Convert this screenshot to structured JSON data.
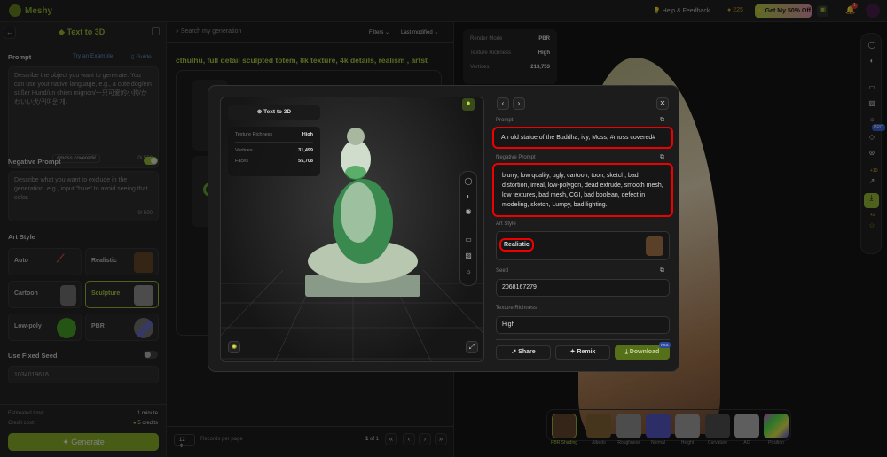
{
  "header": {
    "brand": "Meshy",
    "help": "Help & Feedback",
    "credits": "225",
    "promo": "Get My 50% Off",
    "notifications": "1"
  },
  "left": {
    "back": "←",
    "title": "Text to 3D",
    "prompt_label": "Prompt",
    "try_example": "Try an Example",
    "guide": "Guide",
    "prompt_placeholder": "Describe the object you want to generate. You can use your native language, e.g., a cute dog/ein süßer Hund/un chien mignon/一只可爱的小狗/かわいい犬/귀여운 개.",
    "prompt_tag": "#moss covered#",
    "prompt_count": "0/ 500",
    "neg_label": "Negative Prompt",
    "neg_placeholder": "Describe what you want to exclude in the generation. e.g., input \"blue\" to avoid seeing that color.",
    "neg_count": "0/ 500",
    "neg_enabled": true,
    "art_style_label": "Art Style",
    "styles": [
      {
        "label": "Auto"
      },
      {
        "label": "Realistic"
      },
      {
        "label": "Cartoon"
      },
      {
        "label": "Sculpture",
        "selected": true
      },
      {
        "label": "Low-poly"
      },
      {
        "label": "PBR"
      }
    ],
    "seed_label": "Use Fixed Seed",
    "seed_enabled": false,
    "seed_value": "1034019616",
    "est_label": "Estimated time:",
    "est_value": "1 minute",
    "cost_label": "Credit cost:",
    "cost_value": "5 credits",
    "generate": "Generate"
  },
  "gallery": {
    "search_placeholder": "Search my generation",
    "filters": "Filters",
    "sort": "Last modified",
    "title": "cthulhu, full detail sculpted totem, 8k texture, 4k details, realism , artst",
    "per_page": "12",
    "per_page_label": "Records per page",
    "page": "1",
    "page_of": "of 1"
  },
  "viewer": {
    "info": [
      {
        "k": "Render Mode",
        "v": "PBR"
      },
      {
        "k": "Texture Richness",
        "v": "High"
      },
      {
        "k": "Vertices",
        "v": "213,753"
      }
    ],
    "maps": [
      "PBR Shading",
      "Albedo",
      "Roughness",
      "Normal",
      "Height",
      "Curvature",
      "AO",
      "Position"
    ],
    "pro": "PRO",
    "badge1": "+10",
    "badge2": "+2"
  },
  "modal": {
    "mode": "Text to 3D",
    "texture_label": "Texture Richness",
    "texture": "High",
    "vertices_label": "Vertices",
    "vertices": "31,499",
    "faces_label": "Faces",
    "faces": "55,708",
    "prompt_label": "Prompt",
    "prompt": "An old statue of the Buddha, ivy, Moss, #moss covered#",
    "neg_label": "Negative Prompt",
    "neg": "blurry, low quality, ugly, cartoon, toon, sketch, bad distortion, irreal, low-polygon, dead extrude, smooth mesh, low textures, bad mesh, CGI, bad boolean, defect in modeling, sketch, Lumpy, bad lighting.",
    "art_label": "Art Style",
    "art": "Realistic",
    "seed_label": "Seed",
    "seed": "2068167279",
    "tex_label": "Texture Richness",
    "tex": "High",
    "share": "Share",
    "remix": "Remix",
    "download": "Download",
    "pro": "PRO"
  },
  "colors": {
    "accent": "#7c9a22",
    "highlight": "#e00000"
  }
}
